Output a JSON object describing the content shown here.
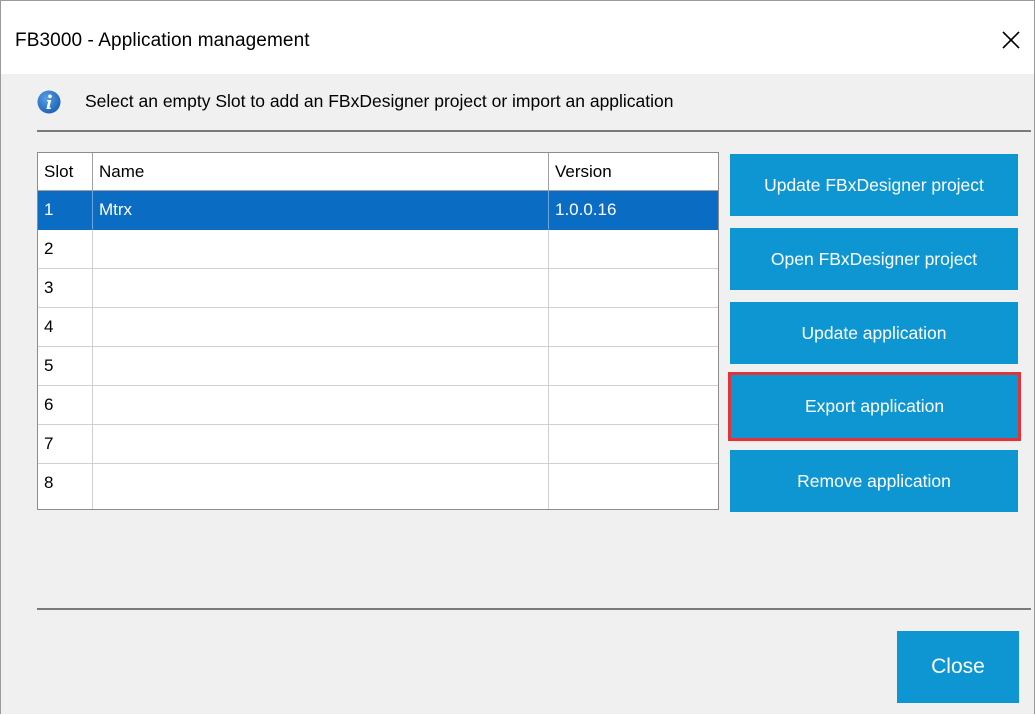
{
  "window": {
    "title": "FB3000 - Application management",
    "close_icon": "close-icon"
  },
  "info": {
    "icon": "info-icon",
    "text": "Select an empty Slot to add an FBxDesigner project or import an application"
  },
  "table": {
    "columns": [
      "Slot",
      "Name",
      "Version"
    ],
    "selected_row": 0,
    "rows": [
      {
        "slot": "1",
        "name": "Mtrx",
        "version": "1.0.0.16"
      },
      {
        "slot": "2",
        "name": "",
        "version": ""
      },
      {
        "slot": "3",
        "name": "",
        "version": ""
      },
      {
        "slot": "4",
        "name": "",
        "version": ""
      },
      {
        "slot": "5",
        "name": "",
        "version": ""
      },
      {
        "slot": "6",
        "name": "",
        "version": ""
      },
      {
        "slot": "7",
        "name": "",
        "version": ""
      },
      {
        "slot": "8",
        "name": "",
        "version": ""
      }
    ]
  },
  "actions": {
    "update_project": "Update FBxDesigner project",
    "open_project": "Open FBxDesigner project",
    "update_application": "Update application",
    "export_application": "Export application",
    "remove_application": "Remove application"
  },
  "footer": {
    "close_label": "Close"
  },
  "colors": {
    "button_blue": "#0e96d2",
    "selection_blue": "#0b6cc4",
    "highlight_red": "#e0333a"
  }
}
